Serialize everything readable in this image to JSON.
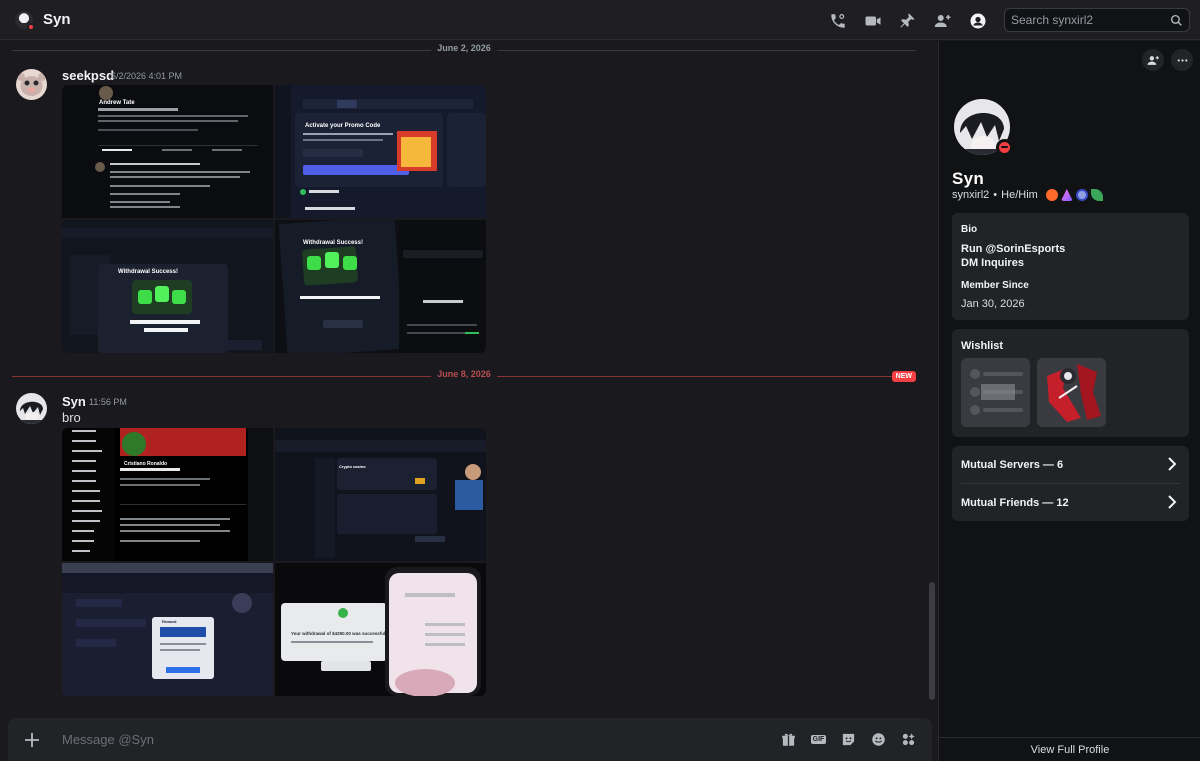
{
  "header": {
    "title": "Syn",
    "search_placeholder": "Search synxirl2"
  },
  "chat": {
    "messages": [
      {
        "date_divider": "June 2, 2026",
        "username": "seekpsd",
        "timestamp": "6/2/2026 4:01 PM",
        "text": "",
        "attachments": [
          {
            "caption": "Andrew Tate"
          },
          {
            "caption": "Activate your Promo Code"
          },
          {
            "caption": "Withdrawal Success!"
          },
          {
            "caption": "Withdrawal Success!"
          }
        ]
      },
      {
        "date_divider": "June 8, 2026",
        "new_badge": "NEW",
        "username": "Syn",
        "timestamp": "11:56 PM",
        "text": "bro",
        "attachments": [
          {
            "caption": "Cristiano Ronaldo"
          },
          {
            "caption": "Crypto casino"
          },
          {
            "caption": "Reward"
          },
          {
            "caption": "Your withdrawal of $4250.00 was successful"
          }
        ]
      }
    ],
    "composer_placeholder": "Message @Syn"
  },
  "profile": {
    "display_name": "Syn",
    "username": "synxirl2",
    "pronouns": "He/Him",
    "bio_label": "Bio",
    "bio_lines": [
      "Run @SorinEsports",
      "DM Inquires"
    ],
    "member_since_label": "Member Since",
    "member_since": "Jan 30, 2026",
    "wishlist_label": "Wishlist",
    "mutual_servers": "Mutual Servers — 6",
    "mutual_friends": "Mutual Friends — 12",
    "view_full_profile": "View Full Profile"
  },
  "colors": {
    "accent_red": "#f23f43",
    "background": "#1a1a1e",
    "panel": "#111214"
  }
}
